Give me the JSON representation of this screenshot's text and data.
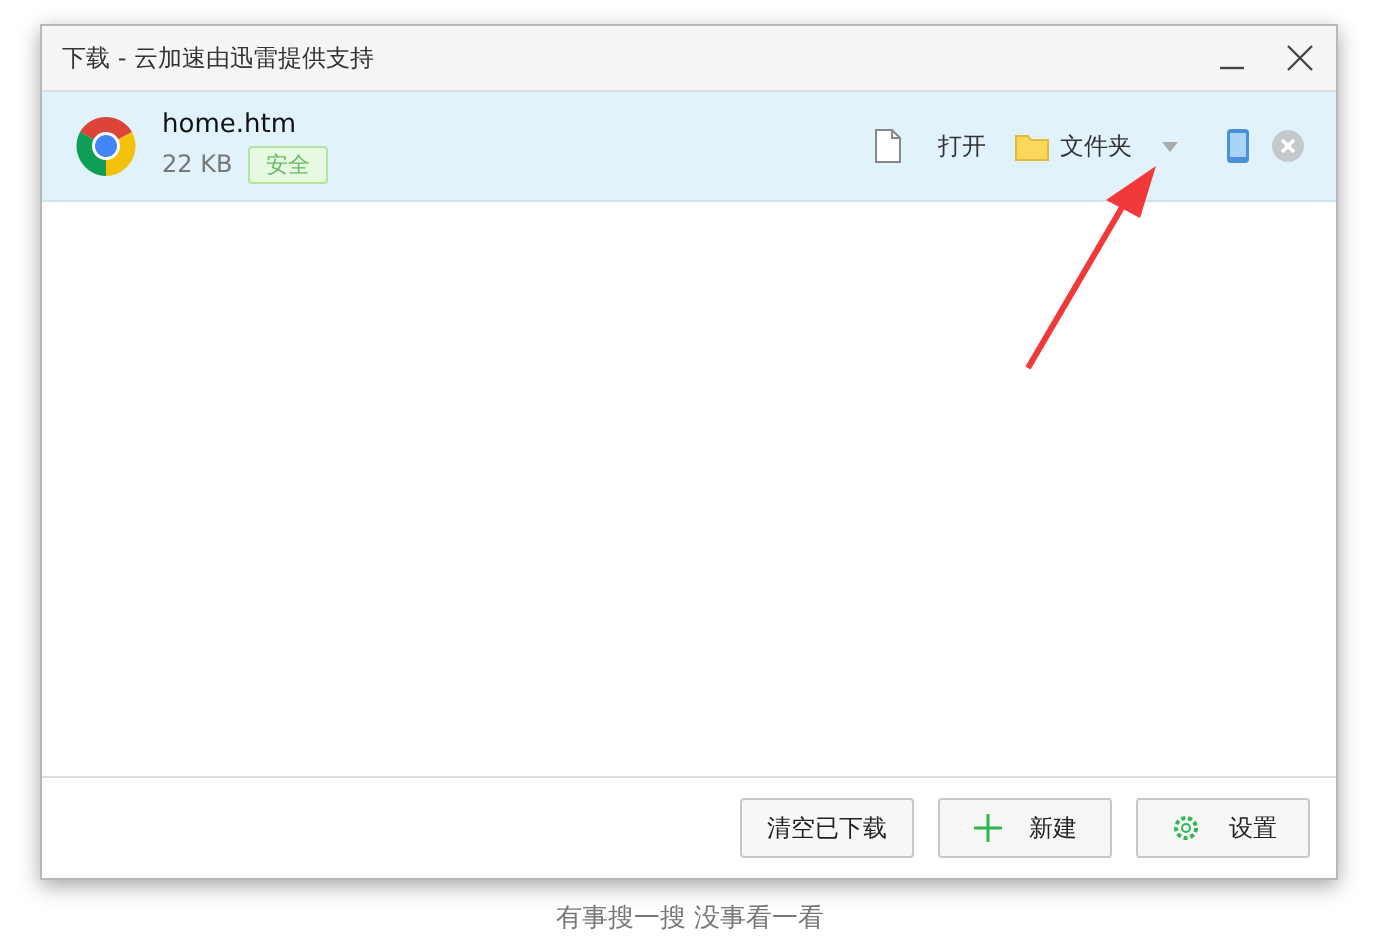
{
  "window": {
    "title": "下载 - 云加速由迅雷提供支持"
  },
  "downloads": [
    {
      "name": "home.htm",
      "size": "22 KB",
      "badge": "安全",
      "selected": true,
      "open_label": "打开",
      "folder_label": "文件夹"
    }
  ],
  "buttons": [
    {
      "kind": "plain",
      "label": "清空已下载"
    },
    {
      "kind": "add",
      "label": "新建"
    },
    {
      "kind": "settings",
      "label": "设置"
    }
  ],
  "background_text": "有事搜一搜 没事看一看"
}
